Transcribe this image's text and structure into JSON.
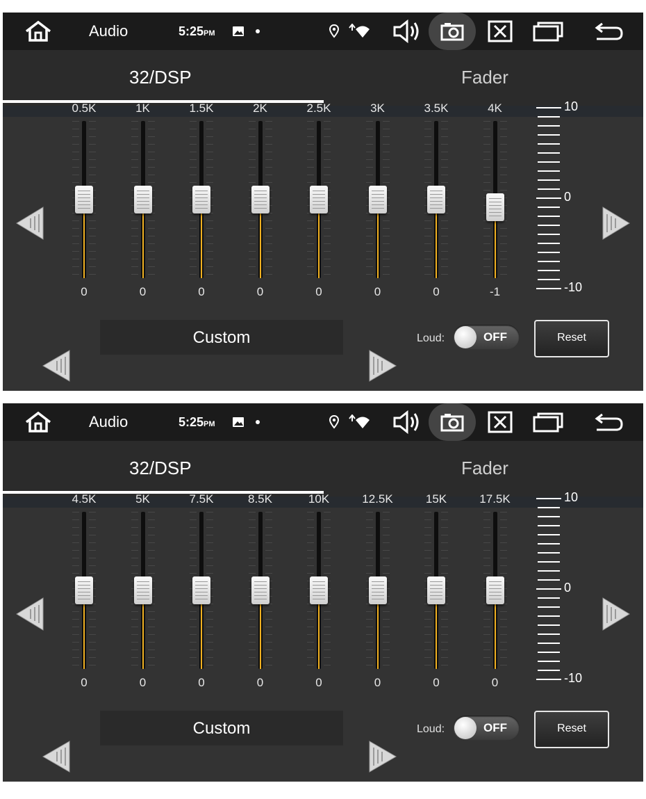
{
  "colors": {
    "accent": "#2ec7e6",
    "slider_fill": "#f0b020",
    "background": "#333333",
    "statusbar": "#1b1b1b"
  },
  "panels": [
    {
      "statusbar": {
        "app_title": "Audio",
        "time": "5:25",
        "ampm": "PM",
        "icons": [
          "home-icon",
          "image-icon",
          "location-icon",
          "wifi-icon",
          "volume-icon",
          "camera-icon",
          "close-box-icon",
          "recent-apps-icon",
          "back-icon"
        ]
      },
      "tabs": [
        {
          "label": "32/DSP",
          "active": true
        },
        {
          "label": "Fader",
          "active": false
        }
      ],
      "bands": [
        {
          "label": "0.5K",
          "value": "0"
        },
        {
          "label": "1K",
          "value": "0"
        },
        {
          "label": "1.5K",
          "value": "0"
        },
        {
          "label": "2K",
          "value": "0"
        },
        {
          "label": "2.5K",
          "value": "0"
        },
        {
          "label": "3K",
          "value": "0"
        },
        {
          "label": "3.5K",
          "value": "0"
        },
        {
          "label": "4K",
          "value": "-1"
        }
      ],
      "scale": {
        "max": "10",
        "mid": "0",
        "min": "-10"
      },
      "preset": "Custom",
      "loud_label": "Loud:",
      "loud_state": "OFF",
      "reset_label": "Reset"
    },
    {
      "statusbar": {
        "app_title": "Audio",
        "time": "5:25",
        "ampm": "PM",
        "icons": [
          "home-icon",
          "image-icon",
          "location-icon",
          "wifi-icon",
          "volume-icon",
          "camera-icon",
          "close-box-icon",
          "recent-apps-icon",
          "back-icon"
        ]
      },
      "tabs": [
        {
          "label": "32/DSP",
          "active": true
        },
        {
          "label": "Fader",
          "active": false
        }
      ],
      "bands": [
        {
          "label": "4.5K",
          "value": "0"
        },
        {
          "label": "5K",
          "value": "0"
        },
        {
          "label": "7.5K",
          "value": "0"
        },
        {
          "label": "8.5K",
          "value": "0"
        },
        {
          "label": "10K",
          "value": "0"
        },
        {
          "label": "12.5K",
          "value": "0"
        },
        {
          "label": "15K",
          "value": "0"
        },
        {
          "label": "17.5K",
          "value": "0"
        }
      ],
      "scale": {
        "max": "10",
        "mid": "0",
        "min": "-10"
      },
      "preset": "Custom",
      "loud_label": "Loud:",
      "loud_state": "OFF",
      "reset_label": "Reset"
    }
  ]
}
